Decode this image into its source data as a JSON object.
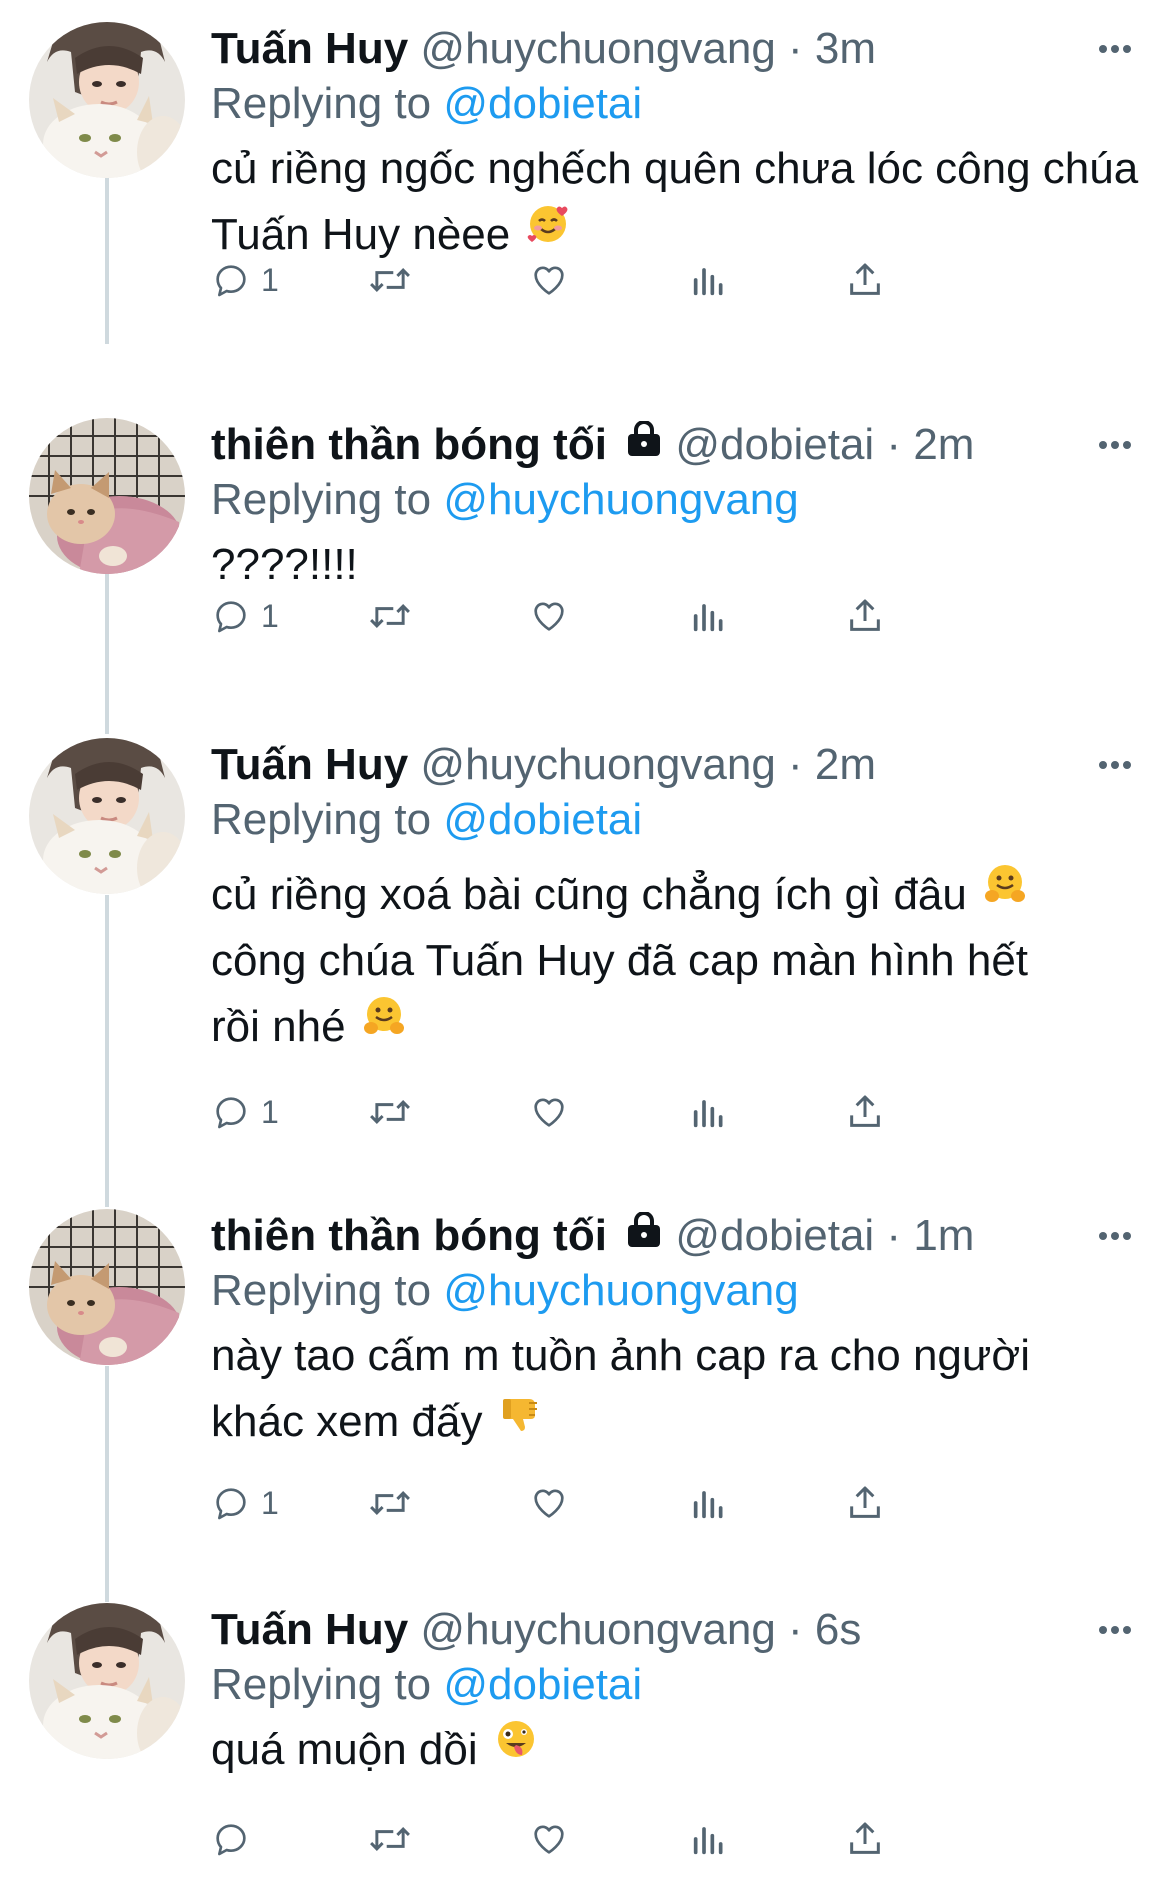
{
  "colors": {
    "text": "#0f1419",
    "secondary": "#536471",
    "link": "#1d9bf0",
    "thread_line": "#cfd9de"
  },
  "tweets": [
    {
      "display_name": "Tuấn Huy",
      "handle": "@huychuongvang",
      "separator": "·",
      "time": "3m",
      "replying_prefix": "Replying to",
      "replying_to": "@dobietai",
      "text": "củ riềng ngốc nghếch quên chưa lóc công chúa Tuấn Huy nèee",
      "emoji": "smiling-face-with-hearts",
      "locked": false,
      "reply_count": "1",
      "avatar": "tuan-huy"
    },
    {
      "display_name": "thiên thần bóng tối",
      "handle": "@dobietai",
      "separator": "·",
      "time": "2m",
      "replying_prefix": "Replying to",
      "replying_to": "@huychuongvang",
      "text": "????!!!!",
      "emoji": "",
      "locked": true,
      "reply_count": "1",
      "avatar": "kitten"
    },
    {
      "display_name": "Tuấn Huy",
      "handle": "@huychuongvang",
      "separator": "·",
      "time": "2m",
      "replying_prefix": "Replying to",
      "replying_to": "@dobietai",
      "text_line1": "củ riềng xoá bài cũng chẳng ích gì đâu",
      "text_line2": "công chúa Tuấn Huy đã cap màn hình hết",
      "text_line3": "rồi nhé",
      "emoji": "hugging-face",
      "locked": false,
      "reply_count": "1",
      "avatar": "tuan-huy"
    },
    {
      "display_name": "thiên thần bóng tối",
      "handle": "@dobietai",
      "separator": "·",
      "time": "1m",
      "replying_prefix": "Replying to",
      "replying_to": "@huychuongvang",
      "text_line1": "này tao cấm m tuồn ảnh cap ra cho người",
      "text_line2": "khác xem đấy",
      "emoji": "thumbs-down",
      "locked": true,
      "reply_count": "1",
      "avatar": "kitten"
    },
    {
      "display_name": "Tuấn Huy",
      "handle": "@huychuongvang",
      "separator": "·",
      "time": "6s",
      "replying_prefix": "Replying to",
      "replying_to": "@dobietai",
      "text": "quá muộn dồi",
      "emoji": "zany-face",
      "locked": false,
      "reply_count": "",
      "avatar": "tuan-huy"
    }
  ],
  "action_icons": [
    "reply-icon",
    "retweet-icon",
    "like-icon",
    "analytics-icon",
    "share-icon"
  ]
}
